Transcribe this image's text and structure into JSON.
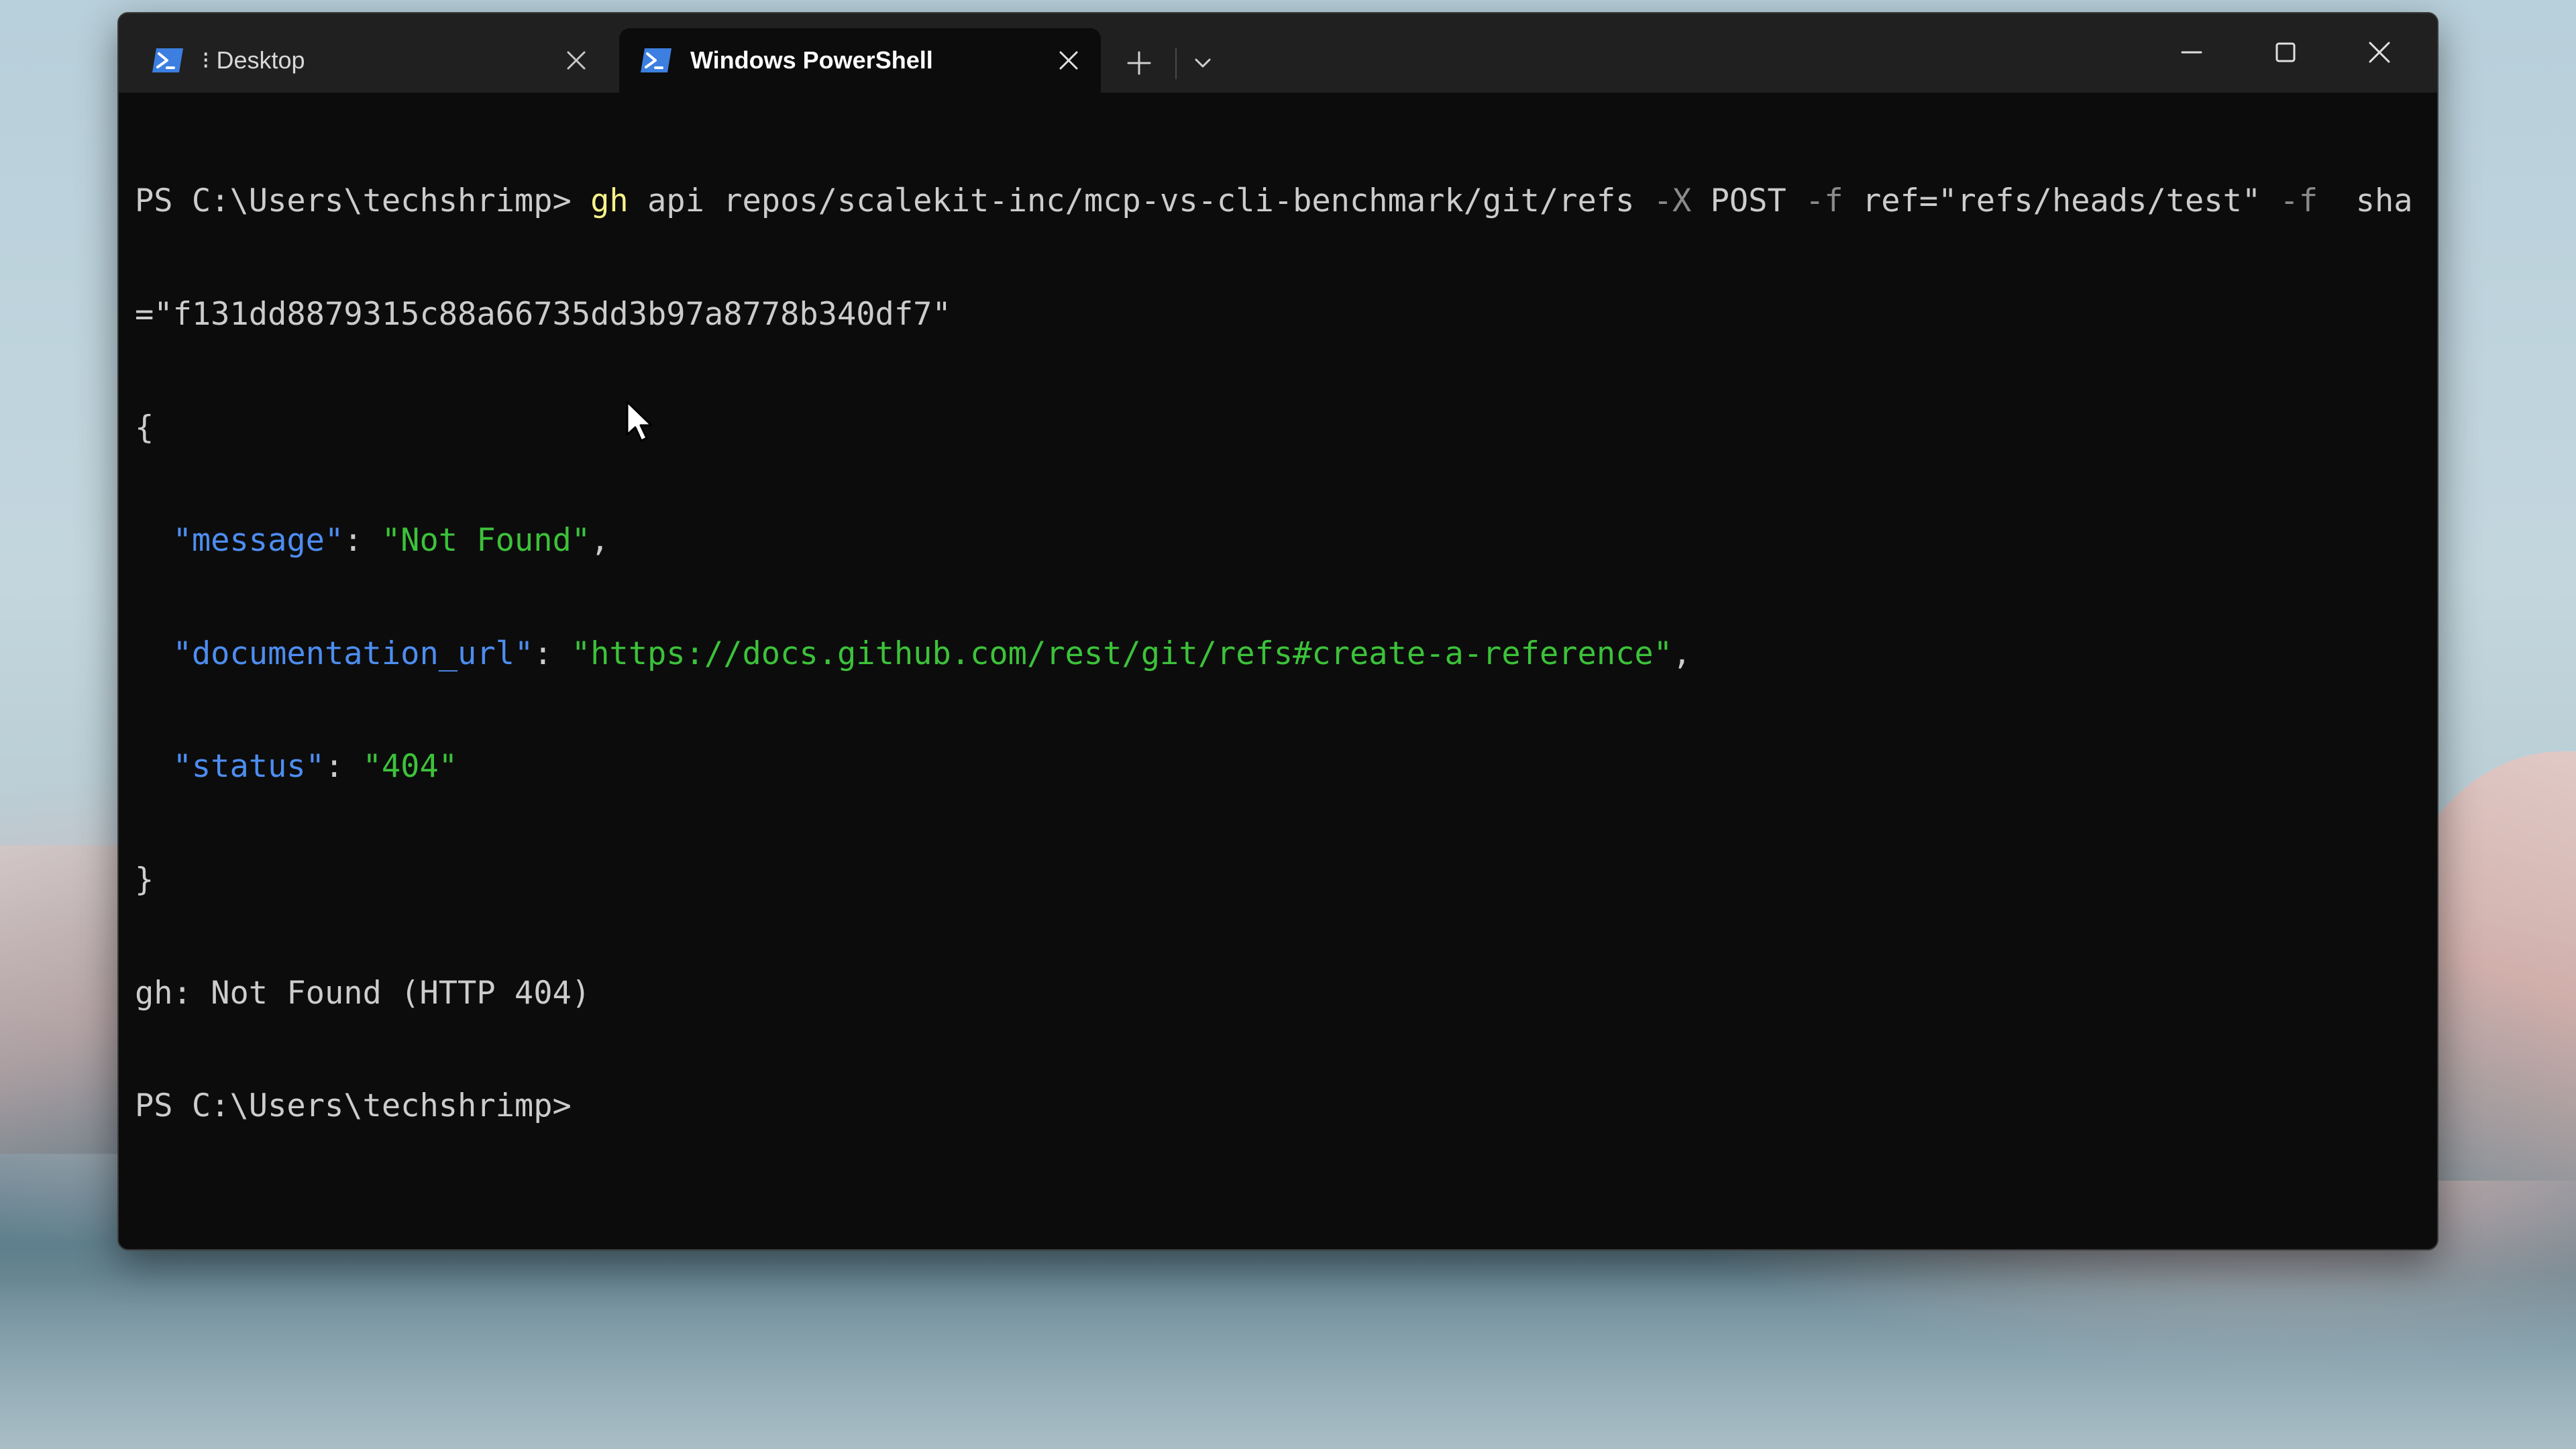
{
  "tabs": [
    {
      "label": "⁝ Desktop",
      "active": false
    },
    {
      "label": "Windows PowerShell",
      "active": true
    }
  ],
  "icons": {
    "tab_icon": "powershell-icon",
    "tab_close": "close-icon",
    "new_tab": "plus-icon",
    "dropdown": "chevron-down-icon",
    "minimize": "minimize-icon",
    "maximize": "maximize-icon",
    "close": "close-icon",
    "pointer": "mouse-pointer-icon"
  },
  "terminal": {
    "command": {
      "prompt": "PS C:\\Users\\techshrimp> ",
      "exe": "gh",
      "seg1": " api repos/scalekit-inc/mcp-vs-cli-benchmark/git/refs ",
      "flag1": "-X",
      "seg2": " POST ",
      "flag2": "-f",
      "seg3": " ref=\"refs/heads/test\" ",
      "flag3": "-f",
      "seg4": "  sha",
      "wrap": "=\"f131dd8879315c88a66735dd3b97a8778b340df7\""
    },
    "json_open": "{",
    "json": [
      {
        "key": "\"message\"",
        "value": "\"Not Found\"",
        "trail": ","
      },
      {
        "key": "\"documentation_url\"",
        "value": "\"https://docs.github.com/rest/git/refs#create-a-reference\"",
        "trail": ","
      },
      {
        "key": "\"status\"",
        "value": "\"404\"",
        "trail": ""
      }
    ],
    "json_close": "}",
    "error": "gh: Not Found (HTTP 404)",
    "prompt2": "PS C:\\Users\\techshrimp>"
  },
  "colors": {
    "terminal_bg": "#0c0c0c",
    "titlebar_bg": "#202020",
    "command_exe": "#f7f18a",
    "flag": "#8a8a8a",
    "json_key": "#4d8df0",
    "json_string": "#3cc23a",
    "powershell_icon": "#3c7fe0"
  }
}
